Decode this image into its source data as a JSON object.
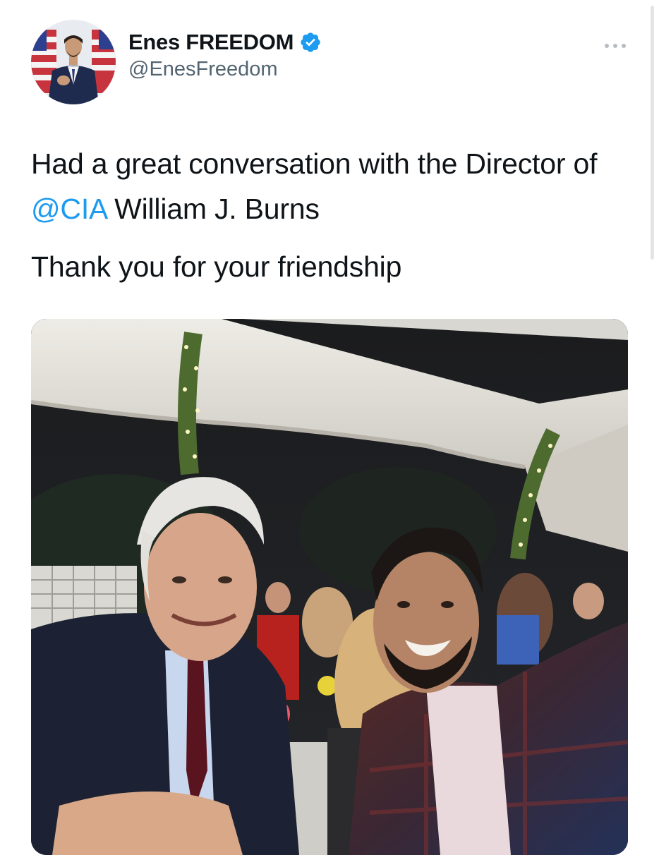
{
  "tweet": {
    "author": {
      "display_name": "Enes FREEDOM",
      "handle": "@EnesFreedom",
      "verified_icon": "verified-badge-icon",
      "avatar_icon": "profile-photo-avatar"
    },
    "more_icon": "more-options-icon",
    "text": {
      "line1_before": "Had a great conversation with the Director of ",
      "mention": "@CIA",
      "line1_after": " William J. Burns",
      "line2": "Thank you for your friendship"
    },
    "media": {
      "kind": "photo",
      "subject": "two men smiling at an evening tent event"
    }
  },
  "colors": {
    "link": "#1d9bf0",
    "verified": "#1d9bf0",
    "secondary_text": "#536471",
    "primary_text": "#0f1419"
  }
}
